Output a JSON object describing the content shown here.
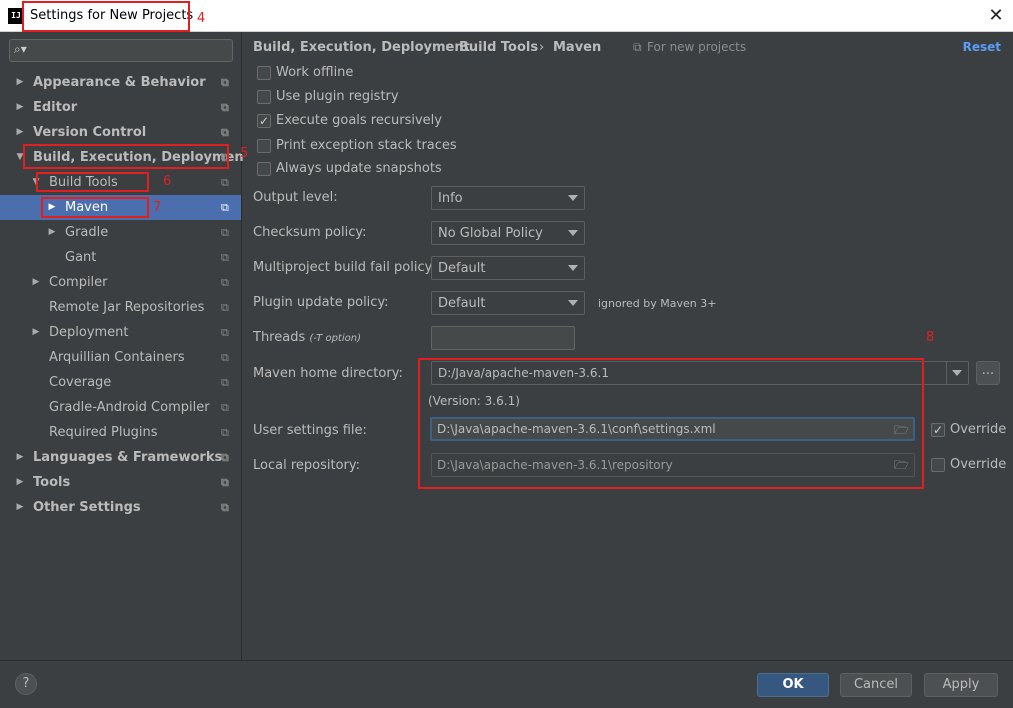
{
  "window": {
    "title": "Settings for New Projects",
    "app_icon_text": "IJ",
    "close_glyph": "✕"
  },
  "search": {
    "placeholder": "",
    "icon": "⌕▾"
  },
  "sidebar": {
    "items": [
      {
        "label": "Appearance & Behavior"
      },
      {
        "label": "Editor"
      },
      {
        "label": "Version Control"
      },
      {
        "label": "Build, Execution, Deployment"
      },
      {
        "label": "Build Tools"
      },
      {
        "label": "Maven"
      },
      {
        "label": "Gradle"
      },
      {
        "label": "Gant"
      },
      {
        "label": "Compiler"
      },
      {
        "label": "Remote Jar Repositories"
      },
      {
        "label": "Deployment"
      },
      {
        "label": "Arquillian Containers"
      },
      {
        "label": "Coverage"
      },
      {
        "label": "Gradle-Android Compiler"
      },
      {
        "label": "Required Plugins"
      },
      {
        "label": "Languages & Frameworks"
      },
      {
        "label": "Tools"
      },
      {
        "label": "Other Settings"
      }
    ],
    "collapsed_arrow": "▶",
    "expanded_arrow": "▼",
    "copy_icon": "⧉"
  },
  "breadcrumb": {
    "items": [
      "Build, Execution, Deployment",
      "Build Tools",
      "Maven"
    ],
    "separator": "›",
    "scope": "For new projects",
    "scope_icon": "⧉",
    "reset": "Reset"
  },
  "options": {
    "work_offline": {
      "label": "Work offline",
      "checked": false
    },
    "use_plugin_registry": {
      "label": "Use plugin registry",
      "checked": false
    },
    "execute_goals_recursively": {
      "label": "Execute goals recursively",
      "checked": true
    },
    "print_exception_stack_traces": {
      "label": "Print exception stack traces",
      "checked": false
    },
    "always_update_snapshots": {
      "label": "Always update snapshots",
      "checked": false
    }
  },
  "form": {
    "output_level": {
      "label": "Output level:",
      "value": "Info"
    },
    "checksum_policy": {
      "label": "Checksum policy:",
      "value": "No Global Policy"
    },
    "fail_policy": {
      "label": "Multiproject build fail policy:",
      "value": "Default"
    },
    "plugin_update_policy": {
      "label": "Plugin update policy:",
      "value": "Default",
      "note": "ignored by Maven 3+"
    },
    "threads": {
      "label": "Threads",
      "hint": "(-T option)",
      "value": ""
    },
    "maven_home": {
      "label": "Maven home directory:",
      "value": "D:/Java/apache-maven-3.6.1",
      "version": "(Version: 3.6.1)",
      "browse": "..."
    },
    "user_settings": {
      "label": "User settings file:",
      "value": "D:\\Java\\apache-maven-3.6.1\\conf\\settings.xml",
      "override_label": "Override",
      "override_checked": true
    },
    "local_repository": {
      "label": "Local repository:",
      "value": "D:\\Java\\apache-maven-3.6.1\\repository",
      "override_label": "Override",
      "override_checked": false
    },
    "folder_icon": "🗁"
  },
  "buttons": {
    "help": "?",
    "ok": "OK",
    "cancel": "Cancel",
    "apply": "Apply"
  },
  "annotations": [
    "4",
    "5",
    "6",
    "7",
    "8"
  ],
  "colors": {
    "background": "#3c3f41",
    "selection": "#4b6eaf",
    "link": "#589df6",
    "annotation": "#e02020",
    "primary_button": "#365880"
  }
}
